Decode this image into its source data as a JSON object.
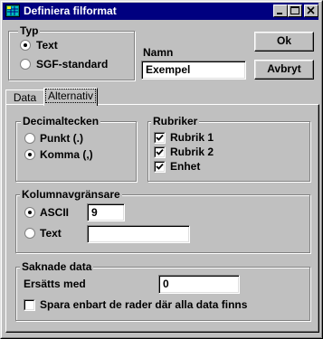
{
  "window": {
    "title": "Definiera filformat",
    "icon": "table-app-icon",
    "controls": [
      "minimize-icon",
      "maximize-icon",
      "close-icon"
    ]
  },
  "typ": {
    "label": "Typ",
    "options": [
      "Text",
      "SGF-standard"
    ],
    "selected": "Text"
  },
  "namn": {
    "label": "Namn",
    "value": "Exempel"
  },
  "buttons": {
    "ok": "Ok",
    "cancel": "Avbryt"
  },
  "tabs": [
    {
      "label": "Data",
      "active": false
    },
    {
      "label": "Alternativ",
      "active": true
    }
  ],
  "decimal": {
    "label": "Decimaltecken",
    "options": [
      "Punkt (.)",
      "Komma (,)"
    ],
    "selected": "Komma (,)"
  },
  "rubriker": {
    "label": "Rubriker",
    "items": [
      {
        "label": "Rubrik 1",
        "checked": true
      },
      {
        "label": "Rubrik 2",
        "checked": true
      },
      {
        "label": "Enhet",
        "checked": true
      }
    ]
  },
  "kolumn": {
    "label": "Kolumnavgränsare",
    "options": [
      "ASCII",
      "Text"
    ],
    "selected": "ASCII",
    "ascii_value": "9",
    "text_value": ""
  },
  "saknade": {
    "label": "Saknade data",
    "replace_label": "Ersätts med",
    "replace_value": "0",
    "only_rows_label": "Spara enbart de rader där alla data finns",
    "only_rows_checked": false
  }
}
